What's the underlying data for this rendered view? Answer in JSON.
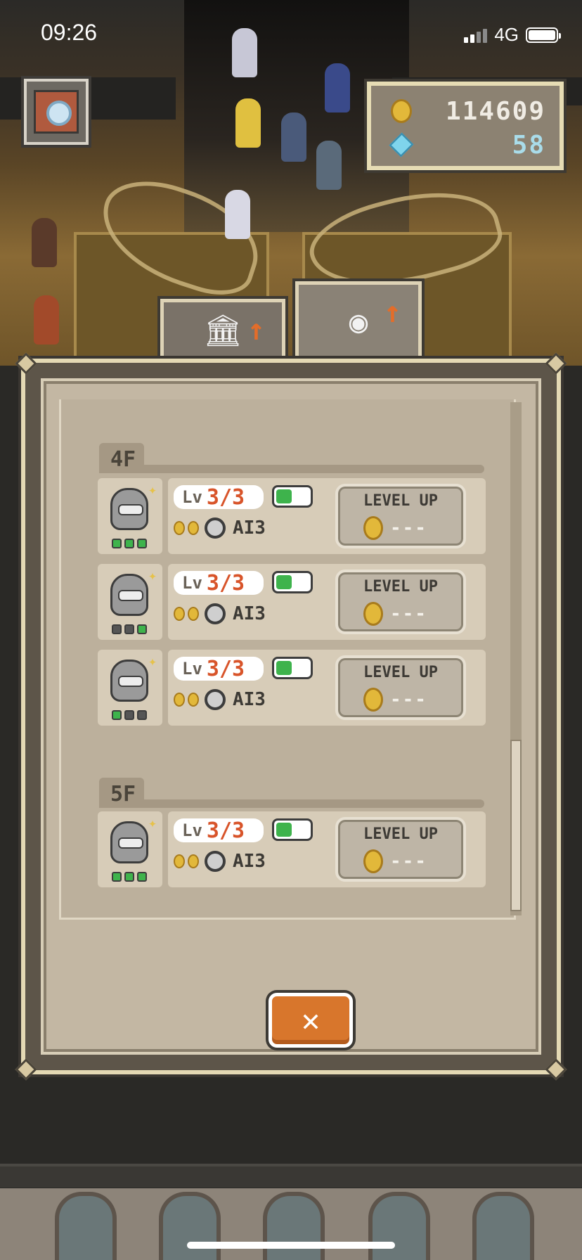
{
  "status_bar": {
    "time": "09:26",
    "network": "4G"
  },
  "currency": {
    "coins": "114609",
    "gems": "58"
  },
  "tabs": [
    {
      "id": "museum-upgrade",
      "icon": "museum-icon",
      "active": false
    },
    {
      "id": "robot-upgrade",
      "icon": "robot-icon",
      "active": true
    }
  ],
  "floors": [
    {
      "label": "4F",
      "robots": [
        {
          "level_label": "Lv",
          "level": "3/3",
          "toggle_on": true,
          "ai_label": "AI3",
          "button_label": "LEVEL UP",
          "cost": "---",
          "indicators": [
            1,
            1,
            1
          ]
        },
        {
          "level_label": "Lv",
          "level": "3/3",
          "toggle_on": true,
          "ai_label": "AI3",
          "button_label": "LEVEL UP",
          "cost": "---",
          "indicators": [
            0,
            0,
            1
          ]
        },
        {
          "level_label": "Lv",
          "level": "3/3",
          "toggle_on": true,
          "ai_label": "AI3",
          "button_label": "LEVEL UP",
          "cost": "---",
          "indicators": [
            1,
            0,
            0
          ]
        }
      ]
    },
    {
      "label": "5F",
      "robots": [
        {
          "level_label": "Lv",
          "level": "3/3",
          "toggle_on": true,
          "ai_label": "AI3",
          "button_label": "LEVEL UP",
          "cost": "---",
          "indicators": [
            1,
            1,
            1
          ]
        }
      ]
    }
  ],
  "close_button": {
    "label": "✕"
  },
  "colors": {
    "accent_orange": "#d8762c",
    "level_red": "#d8542a",
    "toggle_green": "#3eb34c",
    "panel_beige": "#c3b7a3"
  }
}
